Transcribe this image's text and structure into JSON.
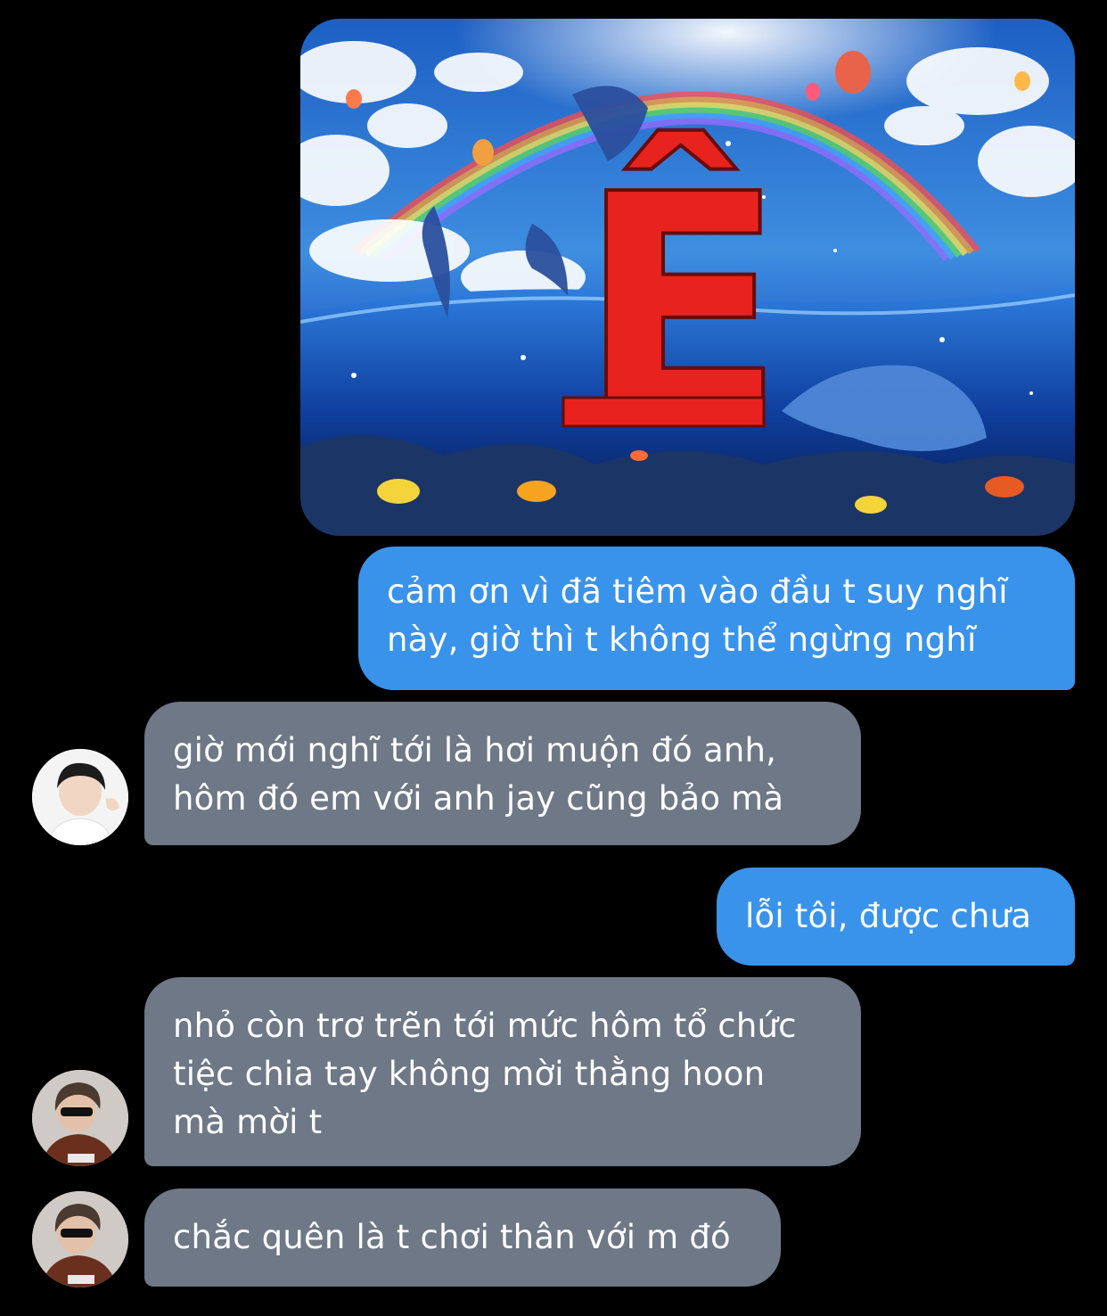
{
  "conversation": {
    "image_message": {
      "letter": "Ê",
      "icon": "dolphin-rainbow-sea-image"
    },
    "messages": [
      {
        "side": "sent",
        "text": "cảm ơn vì đã tiêm vào đầu t suy nghĩ\nnày, giờ thì t không thể ngừng nghĩ"
      },
      {
        "side": "received",
        "text": "giờ mới nghĩ tới là hơi muộn đó anh,\nhôm đó em với anh jay cũng bảo mà"
      },
      {
        "side": "sent",
        "text": "lỗi tôi, được chưa"
      },
      {
        "side": "received",
        "text": "nhỏ còn trơ trẽn tới mức hôm tổ chức\ntiệc chia tay không mời thằng hoon\nmà mời t"
      },
      {
        "side": "received",
        "text": "chắc quên là t chơi thân với m đó"
      }
    ]
  },
  "colors": {
    "background": "#000000",
    "sent_bubble": "#3a93ea",
    "received_bubble": "#6e7886",
    "text": "#ffffff",
    "letter_red": "#e8231f"
  }
}
